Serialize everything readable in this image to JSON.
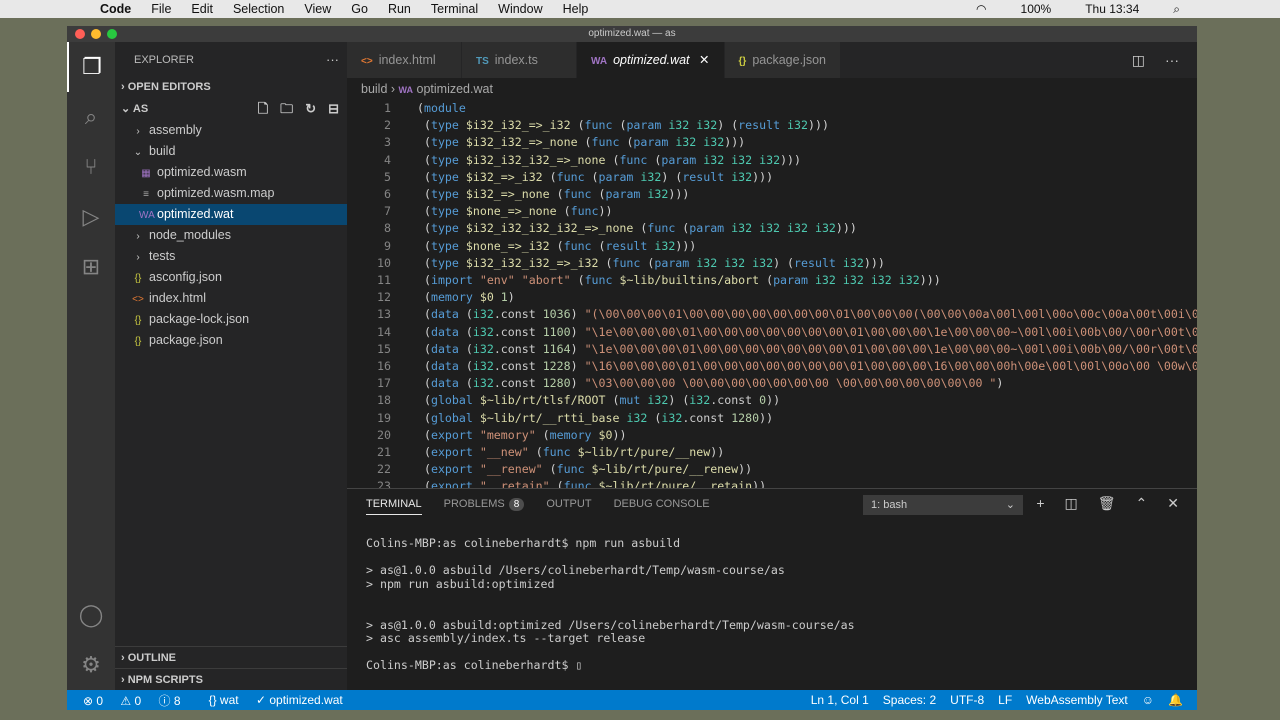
{
  "menubar": {
    "app": "Code",
    "items": [
      "File",
      "Edit",
      "Selection",
      "View",
      "Go",
      "Run",
      "Terminal",
      "Window",
      "Help"
    ],
    "battery": "100%",
    "clock": "Thu 13:34"
  },
  "window": {
    "title": "optimized.wat — as"
  },
  "sidebar": {
    "title": "EXPLORER",
    "open_editors": "OPEN EDITORS",
    "root": "AS",
    "tree": [
      {
        "label": "assembly",
        "kind": "folder",
        "depth": 1,
        "icon": "›"
      },
      {
        "label": "build",
        "kind": "folder-open",
        "depth": 1,
        "icon": "⌄"
      },
      {
        "label": "optimized.wasm",
        "kind": "wasm",
        "depth": 2,
        "icon": "▦"
      },
      {
        "label": "optimized.wasm.map",
        "kind": "map",
        "depth": 2,
        "icon": "≡"
      },
      {
        "label": "optimized.wat",
        "kind": "wat",
        "depth": 2,
        "icon": "WA",
        "selected": true
      },
      {
        "label": "node_modules",
        "kind": "folder",
        "depth": 1,
        "icon": "›"
      },
      {
        "label": "tests",
        "kind": "folder",
        "depth": 1,
        "icon": "›"
      },
      {
        "label": "asconfig.json",
        "kind": "json",
        "depth": 1,
        "icon": "{}"
      },
      {
        "label": "index.html",
        "kind": "html",
        "depth": 1,
        "icon": "<>"
      },
      {
        "label": "package-lock.json",
        "kind": "json",
        "depth": 1,
        "icon": "{}"
      },
      {
        "label": "package.json",
        "kind": "json",
        "depth": 1,
        "icon": "{}"
      }
    ],
    "outline": "OUTLINE",
    "npm_scripts": "NPM SCRIPTS"
  },
  "tabs": [
    {
      "label": "index.html",
      "icon": "<>"
    },
    {
      "label": "index.ts",
      "icon": "TS"
    },
    {
      "label": "optimized.wat",
      "icon": "WA",
      "active": true
    },
    {
      "label": "package.json",
      "icon": "{}"
    }
  ],
  "breadcrumb": [
    "build",
    "optimized.wat"
  ],
  "code": [
    "(module",
    " (type $i32_i32_=>_i32 (func (param i32 i32) (result i32)))",
    " (type $i32_i32_=>_none (func (param i32 i32)))",
    " (type $i32_i32_i32_=>_none (func (param i32 i32 i32)))",
    " (type $i32_=>_i32 (func (param i32) (result i32)))",
    " (type $i32_=>_none (func (param i32)))",
    " (type $none_=>_none (func))",
    " (type $i32_i32_i32_i32_=>_none (func (param i32 i32 i32 i32)))",
    " (type $none_=>_i32 (func (result i32)))",
    " (type $i32_i32_i32_=>_i32 (func (param i32 i32 i32) (result i32)))",
    " (import \"env\" \"abort\" (func $~lib/builtins/abort (param i32 i32 i32 i32)))",
    " (memory $0 1)",
    " (data (i32.const 1036) \"(\\00\\00\\00\\01\\00\\00\\00\\00\\00\\00\\00\\01\\00\\00\\00(\\00\\00\\00a\\00l\\00l\\00o\\00c\\00a\\00t\\00i\\00",
    " (data (i32.const 1100) \"\\1e\\00\\00\\00\\01\\00\\00\\00\\00\\00\\00\\00\\01\\00\\00\\00\\1e\\00\\00\\00~\\00l\\00i\\00b\\00/\\00r\\00t\\00",
    " (data (i32.const 1164) \"\\1e\\00\\00\\00\\01\\00\\00\\00\\00\\00\\00\\00\\01\\00\\00\\00\\1e\\00\\00\\00~\\00l\\00i\\00b\\00/\\00r\\00t\\00",
    " (data (i32.const 1228) \"\\16\\00\\00\\00\\01\\00\\00\\00\\00\\00\\00\\00\\01\\00\\00\\00\\16\\00\\00\\00h\\00e\\00l\\00l\\00o\\00 \\00w\\00",
    " (data (i32.const 1280) \"\\03\\00\\00\\00 \\00\\00\\00\\00\\00\\00\\00 \\00\\00\\00\\00\\00\\00\\00 \")",
    " (global $~lib/rt/tlsf/ROOT (mut i32) (i32.const 0))",
    " (global $~lib/rt/__rtti_base i32 (i32.const 1280))",
    " (export \"memory\" (memory $0))",
    " (export \"__new\" (func $~lib/rt/pure/__new))",
    " (export \"__renew\" (func $~lib/rt/pure/__renew))",
    " (export \"__retain\" (func $~lib/rt/pure/__retain))"
  ],
  "panel": {
    "tabs": [
      "TERMINAL",
      "PROBLEMS",
      "OUTPUT",
      "DEBUG CONSOLE"
    ],
    "problems_count": "8",
    "shell": "1: bash",
    "terminal": "Colins-MBP:as colineberhardt$ npm run asbuild\n\n> as@1.0.0 asbuild /Users/colineberhardt/Temp/wasm-course/as\n> npm run asbuild:optimized\n\n\n> as@1.0.0 asbuild:optimized /Users/colineberhardt/Temp/wasm-course/as\n> asc assembly/index.ts --target release\n\nColins-MBP:as colineberhardt$ ▯"
  },
  "status": {
    "errors": "0",
    "warnings": "0",
    "info": "8",
    "language_mode": "wat",
    "file": "optimized.wat",
    "position": "Ln 1, Col 1",
    "spaces": "Spaces: 2",
    "encoding": "UTF-8",
    "eol": "LF",
    "language": "WebAssembly Text"
  }
}
